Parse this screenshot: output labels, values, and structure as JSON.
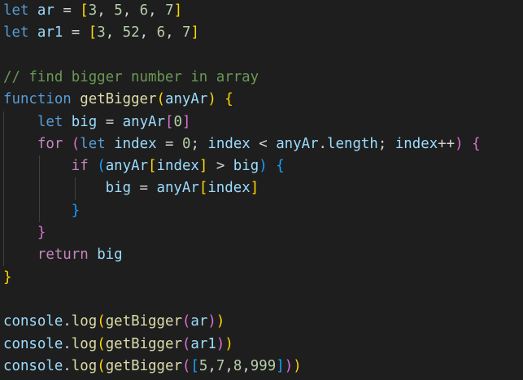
{
  "editor": {
    "lines": [
      {
        "tokens": [
          {
            "t": "let",
            "c": "kw"
          },
          {
            "t": " ",
            "c": "op"
          },
          {
            "t": "ar",
            "c": "var"
          },
          {
            "t": " = ",
            "c": "op"
          },
          {
            "t": "[",
            "c": "b1"
          },
          {
            "t": "3",
            "c": "num"
          },
          {
            "t": ", ",
            "c": "op"
          },
          {
            "t": "5",
            "c": "num"
          },
          {
            "t": ", ",
            "c": "op"
          },
          {
            "t": "6",
            "c": "num"
          },
          {
            "t": ", ",
            "c": "op"
          },
          {
            "t": "7",
            "c": "num"
          },
          {
            "t": "]",
            "c": "b1"
          }
        ]
      },
      {
        "tokens": [
          {
            "t": "let",
            "c": "kw"
          },
          {
            "t": " ",
            "c": "op"
          },
          {
            "t": "ar1",
            "c": "var"
          },
          {
            "t": " = ",
            "c": "op"
          },
          {
            "t": "[",
            "c": "b1"
          },
          {
            "t": "3",
            "c": "num"
          },
          {
            "t": ", ",
            "c": "op"
          },
          {
            "t": "52",
            "c": "num"
          },
          {
            "t": ", ",
            "c": "op"
          },
          {
            "t": "6",
            "c": "num"
          },
          {
            "t": ", ",
            "c": "op"
          },
          {
            "t": "7",
            "c": "num"
          },
          {
            "t": "]",
            "c": "b1"
          }
        ]
      },
      {
        "tokens": []
      },
      {
        "tokens": [
          {
            "t": "// find bigger number in array",
            "c": "cm"
          }
        ]
      },
      {
        "tokens": [
          {
            "t": "function",
            "c": "kw"
          },
          {
            "t": " ",
            "c": "op"
          },
          {
            "t": "getBigger",
            "c": "fn"
          },
          {
            "t": "(",
            "c": "b1"
          },
          {
            "t": "anyAr",
            "c": "var"
          },
          {
            "t": ")",
            "c": "b1"
          },
          {
            "t": " ",
            "c": "op"
          },
          {
            "t": "{",
            "c": "b1"
          }
        ]
      },
      {
        "tokens": [
          {
            "t": "    ",
            "c": "op"
          },
          {
            "t": "let",
            "c": "kw"
          },
          {
            "t": " ",
            "c": "op"
          },
          {
            "t": "big",
            "c": "var"
          },
          {
            "t": " = ",
            "c": "op"
          },
          {
            "t": "anyAr",
            "c": "var"
          },
          {
            "t": "[",
            "c": "b2"
          },
          {
            "t": "0",
            "c": "num"
          },
          {
            "t": "]",
            "c": "b2"
          }
        ]
      },
      {
        "tokens": [
          {
            "t": "    ",
            "c": "op"
          },
          {
            "t": "for",
            "c": "ctl"
          },
          {
            "t": " ",
            "c": "op"
          },
          {
            "t": "(",
            "c": "b2"
          },
          {
            "t": "let",
            "c": "kw"
          },
          {
            "t": " ",
            "c": "op"
          },
          {
            "t": "index",
            "c": "var"
          },
          {
            "t": " = ",
            "c": "op"
          },
          {
            "t": "0",
            "c": "num"
          },
          {
            "t": "; ",
            "c": "op"
          },
          {
            "t": "index",
            "c": "var"
          },
          {
            "t": " < ",
            "c": "op"
          },
          {
            "t": "anyAr",
            "c": "var"
          },
          {
            "t": ".",
            "c": "op"
          },
          {
            "t": "length",
            "c": "var"
          },
          {
            "t": "; ",
            "c": "op"
          },
          {
            "t": "index",
            "c": "var"
          },
          {
            "t": "++",
            "c": "op"
          },
          {
            "t": ")",
            "c": "b2"
          },
          {
            "t": " ",
            "c": "op"
          },
          {
            "t": "{",
            "c": "b2"
          }
        ]
      },
      {
        "tokens": [
          {
            "t": "        ",
            "c": "op"
          },
          {
            "t": "if",
            "c": "ctl"
          },
          {
            "t": " ",
            "c": "op"
          },
          {
            "t": "(",
            "c": "b3"
          },
          {
            "t": "anyAr",
            "c": "var"
          },
          {
            "t": "[",
            "c": "b1"
          },
          {
            "t": "index",
            "c": "var"
          },
          {
            "t": "]",
            "c": "b1"
          },
          {
            "t": " > ",
            "c": "op"
          },
          {
            "t": "big",
            "c": "var"
          },
          {
            "t": ")",
            "c": "b3"
          },
          {
            "t": " ",
            "c": "op"
          },
          {
            "t": "{",
            "c": "b3"
          }
        ]
      },
      {
        "tokens": [
          {
            "t": "            ",
            "c": "op"
          },
          {
            "t": "big",
            "c": "var"
          },
          {
            "t": " = ",
            "c": "op"
          },
          {
            "t": "anyAr",
            "c": "var"
          },
          {
            "t": "[",
            "c": "b1"
          },
          {
            "t": "index",
            "c": "var"
          },
          {
            "t": "]",
            "c": "b1"
          }
        ]
      },
      {
        "tokens": [
          {
            "t": "        ",
            "c": "op"
          },
          {
            "t": "}",
            "c": "b3"
          }
        ]
      },
      {
        "tokens": [
          {
            "t": "    ",
            "c": "op"
          },
          {
            "t": "}",
            "c": "b2"
          }
        ]
      },
      {
        "tokens": [
          {
            "t": "    ",
            "c": "op"
          },
          {
            "t": "return",
            "c": "ctl"
          },
          {
            "t": " ",
            "c": "op"
          },
          {
            "t": "big",
            "c": "var"
          }
        ]
      },
      {
        "tokens": [
          {
            "t": "}",
            "c": "b1"
          }
        ]
      },
      {
        "tokens": []
      },
      {
        "tokens": [
          {
            "t": "console",
            "c": "var"
          },
          {
            "t": ".",
            "c": "op"
          },
          {
            "t": "log",
            "c": "fn"
          },
          {
            "t": "(",
            "c": "b1"
          },
          {
            "t": "getBigger",
            "c": "fn"
          },
          {
            "t": "(",
            "c": "b2"
          },
          {
            "t": "ar",
            "c": "var"
          },
          {
            "t": ")",
            "c": "b2"
          },
          {
            "t": ")",
            "c": "b1"
          }
        ]
      },
      {
        "tokens": [
          {
            "t": "console",
            "c": "var"
          },
          {
            "t": ".",
            "c": "op"
          },
          {
            "t": "log",
            "c": "fn"
          },
          {
            "t": "(",
            "c": "b1"
          },
          {
            "t": "getBigger",
            "c": "fn"
          },
          {
            "t": "(",
            "c": "b2"
          },
          {
            "t": "ar1",
            "c": "var"
          },
          {
            "t": ")",
            "c": "b2"
          },
          {
            "t": ")",
            "c": "b1"
          }
        ]
      },
      {
        "tokens": [
          {
            "t": "console",
            "c": "var"
          },
          {
            "t": ".",
            "c": "op"
          },
          {
            "t": "log",
            "c": "fn"
          },
          {
            "t": "(",
            "c": "b1"
          },
          {
            "t": "getBigger",
            "c": "fn"
          },
          {
            "t": "(",
            "c": "b2"
          },
          {
            "t": "[",
            "c": "b3"
          },
          {
            "t": "5",
            "c": "num"
          },
          {
            "t": ",",
            "c": "op"
          },
          {
            "t": "7",
            "c": "num"
          },
          {
            "t": ",",
            "c": "op"
          },
          {
            "t": "8",
            "c": "num"
          },
          {
            "t": ",",
            "c": "op"
          },
          {
            "t": "999",
            "c": "num"
          },
          {
            "t": "]",
            "c": "b3"
          },
          {
            "t": ")",
            "c": "b2"
          },
          {
            "t": ")",
            "c": "b1"
          }
        ]
      }
    ]
  },
  "colors": {
    "background": "#1e1e1e",
    "keyword": "#569cd6",
    "control": "#c586c0",
    "variable": "#9cdcfe",
    "function": "#dcdcaa",
    "number": "#b5cea8",
    "comment": "#6a9955",
    "bracket_level_1": "#ffd700",
    "bracket_level_2": "#da70d6",
    "bracket_level_3": "#179fff"
  }
}
